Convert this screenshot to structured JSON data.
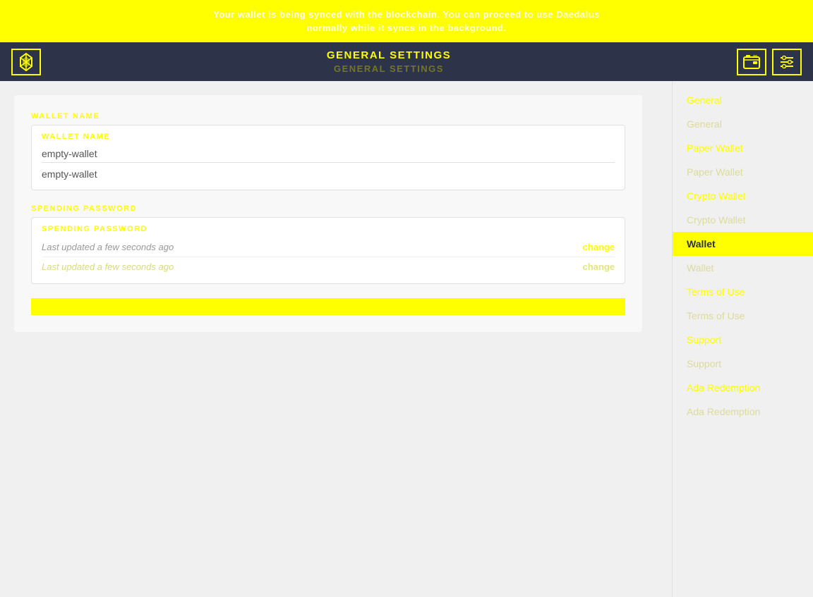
{
  "topBanner": {
    "line1": "Your wallet is being synced with the blockchain. You can proceed to use Daedalus",
    "line2": "normally while it syncs in the background."
  },
  "navbar": {
    "title1": "GENERAL SETTINGS",
    "title2": "GENERAL SETTINGS",
    "logoIcon": "⚡",
    "walletIcon": "🏦",
    "settingsIcon": "⚙"
  },
  "sidebar": {
    "items": [
      {
        "id": "general",
        "label": "General",
        "shadow": "General",
        "active": false
      },
      {
        "id": "general2",
        "label": "General",
        "shadow": "General",
        "active": false
      },
      {
        "id": "paper-wallet",
        "label": "Paper Wallet",
        "shadow": "Paper Wallet",
        "active": false
      },
      {
        "id": "crypto-wallet",
        "label": "Crypto Wallet",
        "shadow": "Crypto Wallet",
        "active": false
      },
      {
        "id": "wallet",
        "label": "Wallet",
        "shadow": "Wallet",
        "active": true
      },
      {
        "id": "wallet2",
        "label": "Wallet",
        "shadow": "Wallet",
        "active": false
      },
      {
        "id": "terms-of-use",
        "label": "Terms of Use",
        "shadow": "Terms of Use",
        "active": false
      },
      {
        "id": "terms-of-use2",
        "label": "Terms of Use",
        "shadow": "Terms of Use",
        "active": false
      },
      {
        "id": "support",
        "label": "Support",
        "shadow": "Support",
        "active": false
      },
      {
        "id": "support2",
        "label": "Support",
        "shadow": "Support",
        "active": false
      },
      {
        "id": "ada-redemption",
        "label": "Ada Redemption",
        "shadow": "Ada Redemption",
        "active": false
      },
      {
        "id": "ada-redemption2",
        "label": "Ada Redemption",
        "shadow": "Ada Redemption",
        "active": false
      }
    ]
  },
  "walletNameSection": {
    "label": "WALLET NAME",
    "innerLabel": "WALLET NAME",
    "value1": "empty-wallet",
    "value2": "empty-wallet"
  },
  "spendingPasswordSection": {
    "label": "SPENDING PASSWORD",
    "innerLabel": "SPENDING PASSWORD",
    "row1": {
      "text": "Last updated a few seconds ago",
      "changeLabel": "change"
    },
    "row2": {
      "text": "Last updated a few seconds ago",
      "changeLabel": "change"
    }
  },
  "saveButton": {
    "label": ""
  }
}
